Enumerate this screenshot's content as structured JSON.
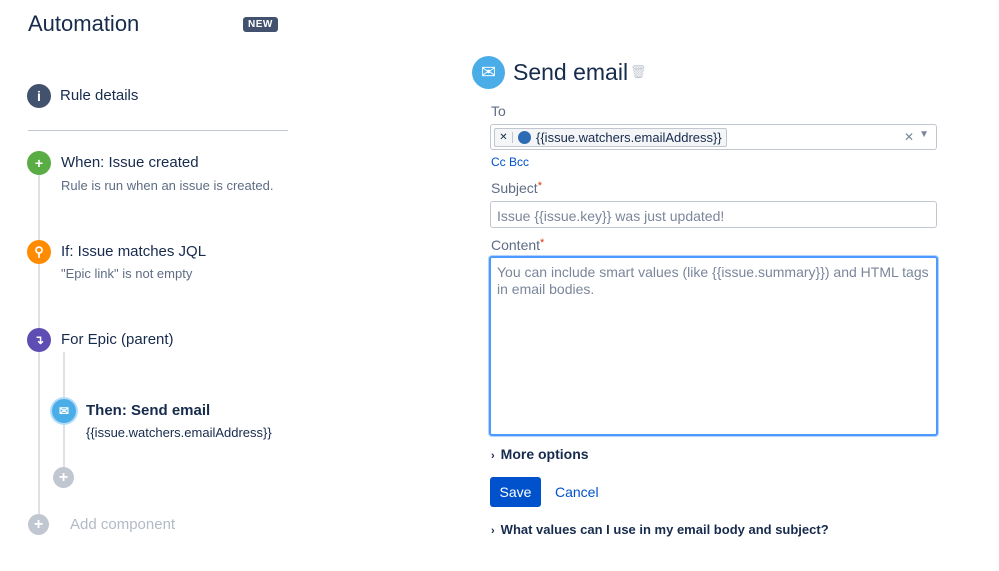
{
  "sidebar": {
    "title": "Automation",
    "badge": "NEW",
    "rule_details": "Rule details",
    "steps": [
      {
        "title": "When: Issue created",
        "desc": "Rule is run when an issue is created.",
        "color": "#5aac44"
      },
      {
        "title": "If: Issue matches JQL",
        "desc": "\"Epic link\" is not empty",
        "color": "#ff8b00"
      },
      {
        "title": "For Epic (parent)",
        "color": "#5e4db2"
      },
      {
        "title": "Then: Send email",
        "desc": "{{issue.watchers.emailAddress}}",
        "color": "#4bade8"
      }
    ],
    "add_component": "Add component"
  },
  "panel": {
    "title": "Send email",
    "to_label": "To",
    "to_tag": "{{issue.watchers.emailAddress}}",
    "cc_bcc": "Cc Bcc",
    "subject_label": "Subject",
    "subject_placeholder": "Issue {{issue.key}} was just updated!",
    "content_label": "Content",
    "content_placeholder": "You can include smart values (like {{issue.summary}}) and HTML tags in email bodies.",
    "more_options": "More options",
    "save": "Save",
    "cancel": "Cancel",
    "help": "What values can I use in my email body and subject?"
  }
}
